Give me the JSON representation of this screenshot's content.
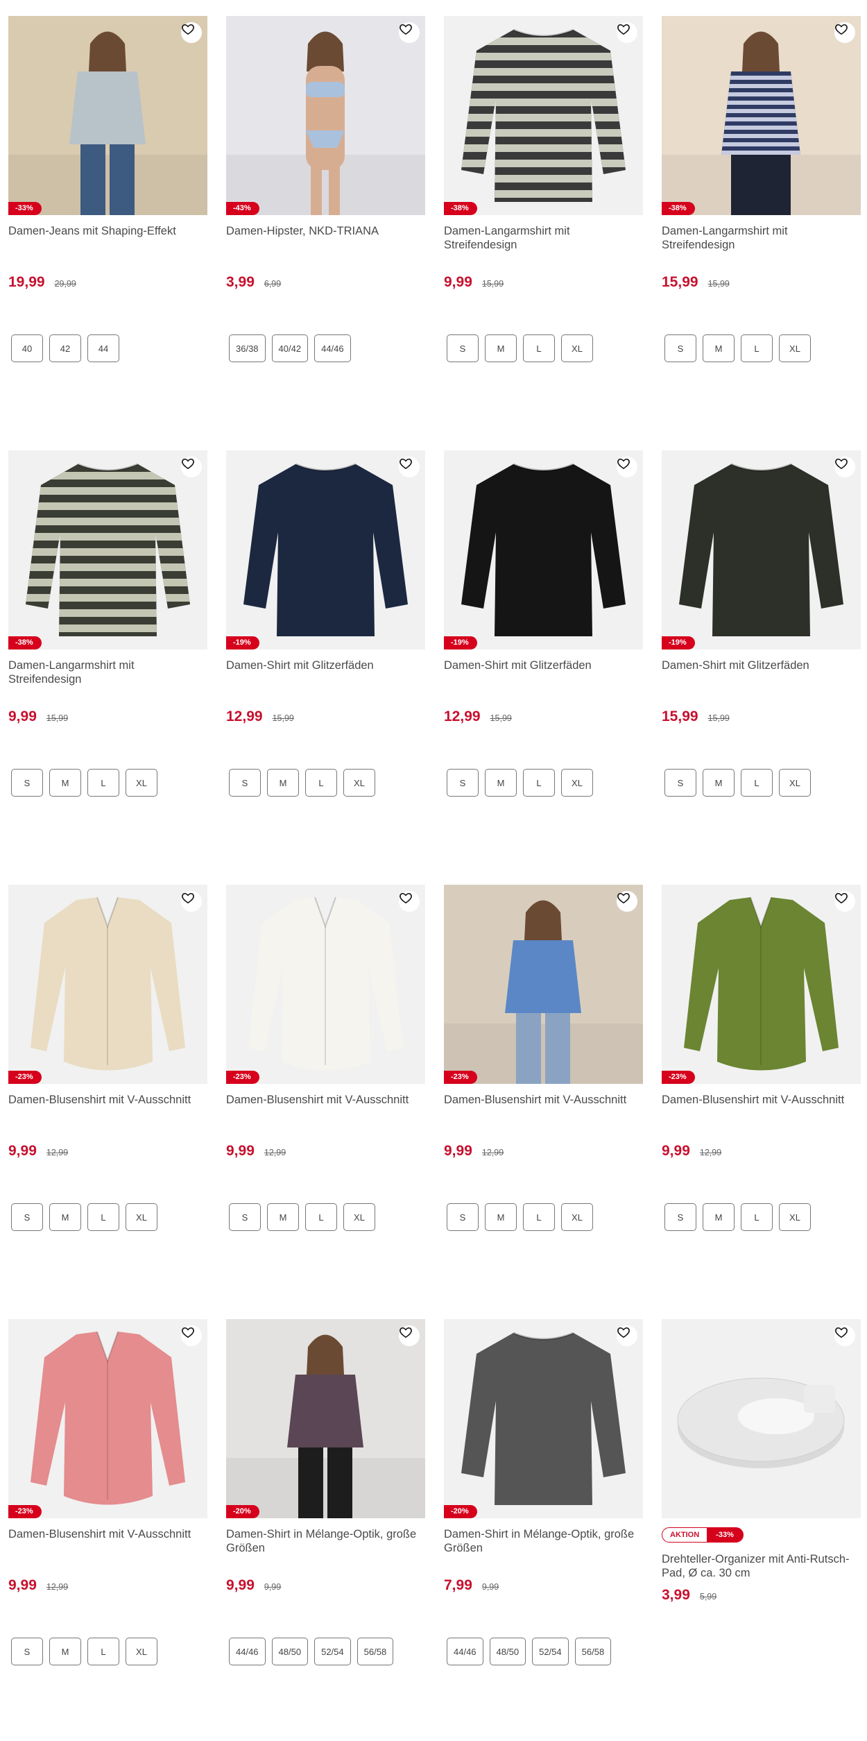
{
  "products": [
    {
      "title": "Damen-Jeans mit Shaping-Effekt",
      "discount": "-33%",
      "price": "19,99",
      "old_price": "29,99",
      "sizes": [
        "40",
        "42",
        "44"
      ],
      "image": "woman-jeans-photo",
      "colors": {
        "bg": "#d9cbb0",
        "top": "#b8c2c9",
        "bottom": "#3d5a80"
      }
    },
    {
      "title": "Damen-Hipster, NKD-TRIANA",
      "discount": "-43%",
      "price": "3,99",
      "old_price": "6,99",
      "sizes": [
        "36/38",
        "40/42",
        "44/46"
      ],
      "image": "woman-lingerie-photo",
      "colors": {
        "bg": "#e6e6ea",
        "top": "#a9c1dd",
        "bottom": "#a9c1dd"
      }
    },
    {
      "title": "Damen-Langarmshirt mit Streifendesign",
      "discount": "-38%",
      "price": "9,99",
      "old_price": "15,99",
      "sizes": [
        "S",
        "M",
        "L",
        "XL"
      ],
      "image": "striped-shirt",
      "colors": {
        "bg": "#f1f1f1",
        "a": "#3a3a3a",
        "b": "#c9cbbd"
      }
    },
    {
      "title": "Damen-Langarmshirt mit Streifendesign",
      "discount": "-38%",
      "price": "15,99",
      "old_price": "15,99",
      "sizes": [
        "S",
        "M",
        "L",
        "XL"
      ],
      "image": "woman-striped-shirt-photo",
      "colors": {
        "bg": "#e9dccb",
        "a": "#2f3b63",
        "b": "#c6cbe0"
      }
    },
    {
      "title": "Damen-Langarmshirt mit Streifendesign",
      "discount": "-38%",
      "price": "9,99",
      "old_price": "15,99",
      "sizes": [
        "S",
        "M",
        "L",
        "XL"
      ],
      "image": "striped-shirt",
      "colors": {
        "bg": "#f1f1f1",
        "a": "#3a3d33",
        "b": "#c4c6b4"
      }
    },
    {
      "title": "Damen-Shirt mit Glitzerfäden",
      "discount": "-19%",
      "price": "12,99",
      "old_price": "15,99",
      "sizes": [
        "S",
        "M",
        "L",
        "XL"
      ],
      "image": "shirt",
      "colors": {
        "bg": "#f1f1f1",
        "a": "#1c2840"
      }
    },
    {
      "title": "Damen-Shirt mit Glitzerfäden",
      "discount": "-19%",
      "price": "12,99",
      "old_price": "15,99",
      "sizes": [
        "S",
        "M",
        "L",
        "XL"
      ],
      "image": "shirt",
      "colors": {
        "bg": "#f1f1f1",
        "a": "#151515"
      }
    },
    {
      "title": "Damen-Shirt mit Glitzerfäden",
      "discount": "-19%",
      "price": "15,99",
      "old_price": "15,99",
      "sizes": [
        "S",
        "M",
        "L",
        "XL"
      ],
      "image": "shirt",
      "colors": {
        "bg": "#f1f1f1",
        "a": "#2c3028"
      }
    },
    {
      "title": "Damen-Blusenshirt mit V-Ausschnitt",
      "discount": "-23%",
      "price": "9,99",
      "old_price": "12,99",
      "sizes": [
        "S",
        "M",
        "L",
        "XL"
      ],
      "image": "blouse",
      "colors": {
        "bg": "#f1f1f1",
        "a": "#e9dcc2"
      }
    },
    {
      "title": "Damen-Blusenshirt mit V-Ausschnitt",
      "discount": "-23%",
      "price": "9,99",
      "old_price": "12,99",
      "sizes": [
        "S",
        "M",
        "L",
        "XL"
      ],
      "image": "blouse",
      "colors": {
        "bg": "#f1f1f1",
        "a": "#f6f4ee"
      }
    },
    {
      "title": "Damen-Blusenshirt mit V-Ausschnitt",
      "discount": "-23%",
      "price": "9,99",
      "old_price": "12,99",
      "sizes": [
        "S",
        "M",
        "L",
        "XL"
      ],
      "image": "woman-blouse-photo",
      "colors": {
        "bg": "#d8cdbd",
        "a": "#5b87c6"
      }
    },
    {
      "title": "Damen-Blusenshirt mit V-Ausschnitt",
      "discount": "-23%",
      "price": "9,99",
      "old_price": "12,99",
      "sizes": [
        "S",
        "M",
        "L",
        "XL"
      ],
      "image": "blouse",
      "colors": {
        "bg": "#f1f1f1",
        "a": "#6b8532"
      }
    },
    {
      "title": "Damen-Blusenshirt mit V-Ausschnitt",
      "discount": "-23%",
      "price": "9,99",
      "old_price": "12,99",
      "sizes": [
        "S",
        "M",
        "L",
        "XL"
      ],
      "image": "blouse",
      "colors": {
        "bg": "#f1f1f1",
        "a": "#e48c8e"
      }
    },
    {
      "title": "Damen-Shirt in Mélange-Optik, große Größen",
      "discount": "-20%",
      "price": "9,99",
      "old_price": "9,99",
      "sizes": [
        "44/46",
        "48/50",
        "52/54",
        "56/58"
      ],
      "image": "woman-shirt-photo",
      "colors": {
        "bg": "#e4e2e0",
        "a": "#5a4654",
        "b": "#1d1d1d"
      }
    },
    {
      "title": "Damen-Shirt in Mélange-Optik, große Größen",
      "discount": "-20%",
      "price": "7,99",
      "old_price": "9,99",
      "sizes": [
        "44/46",
        "48/50",
        "52/54",
        "56/58"
      ],
      "image": "shirt",
      "colors": {
        "bg": "#f1f1f1",
        "a": "#555555"
      }
    },
    {
      "title": "Drehteller-Organizer mit Anti-Rutsch-Pad, Ø ca. 30 cm",
      "badge": "AKTION",
      "discount": "-33%",
      "price": "3,99",
      "old_price": "5,99",
      "sizes": [],
      "image": "turntable-organizer",
      "colors": {
        "bg": "#f1f1f1",
        "a": "#e7e7e7"
      }
    }
  ],
  "icons": {
    "favorite": "heart-outline-icon"
  },
  "accent_color": "#c8102e"
}
